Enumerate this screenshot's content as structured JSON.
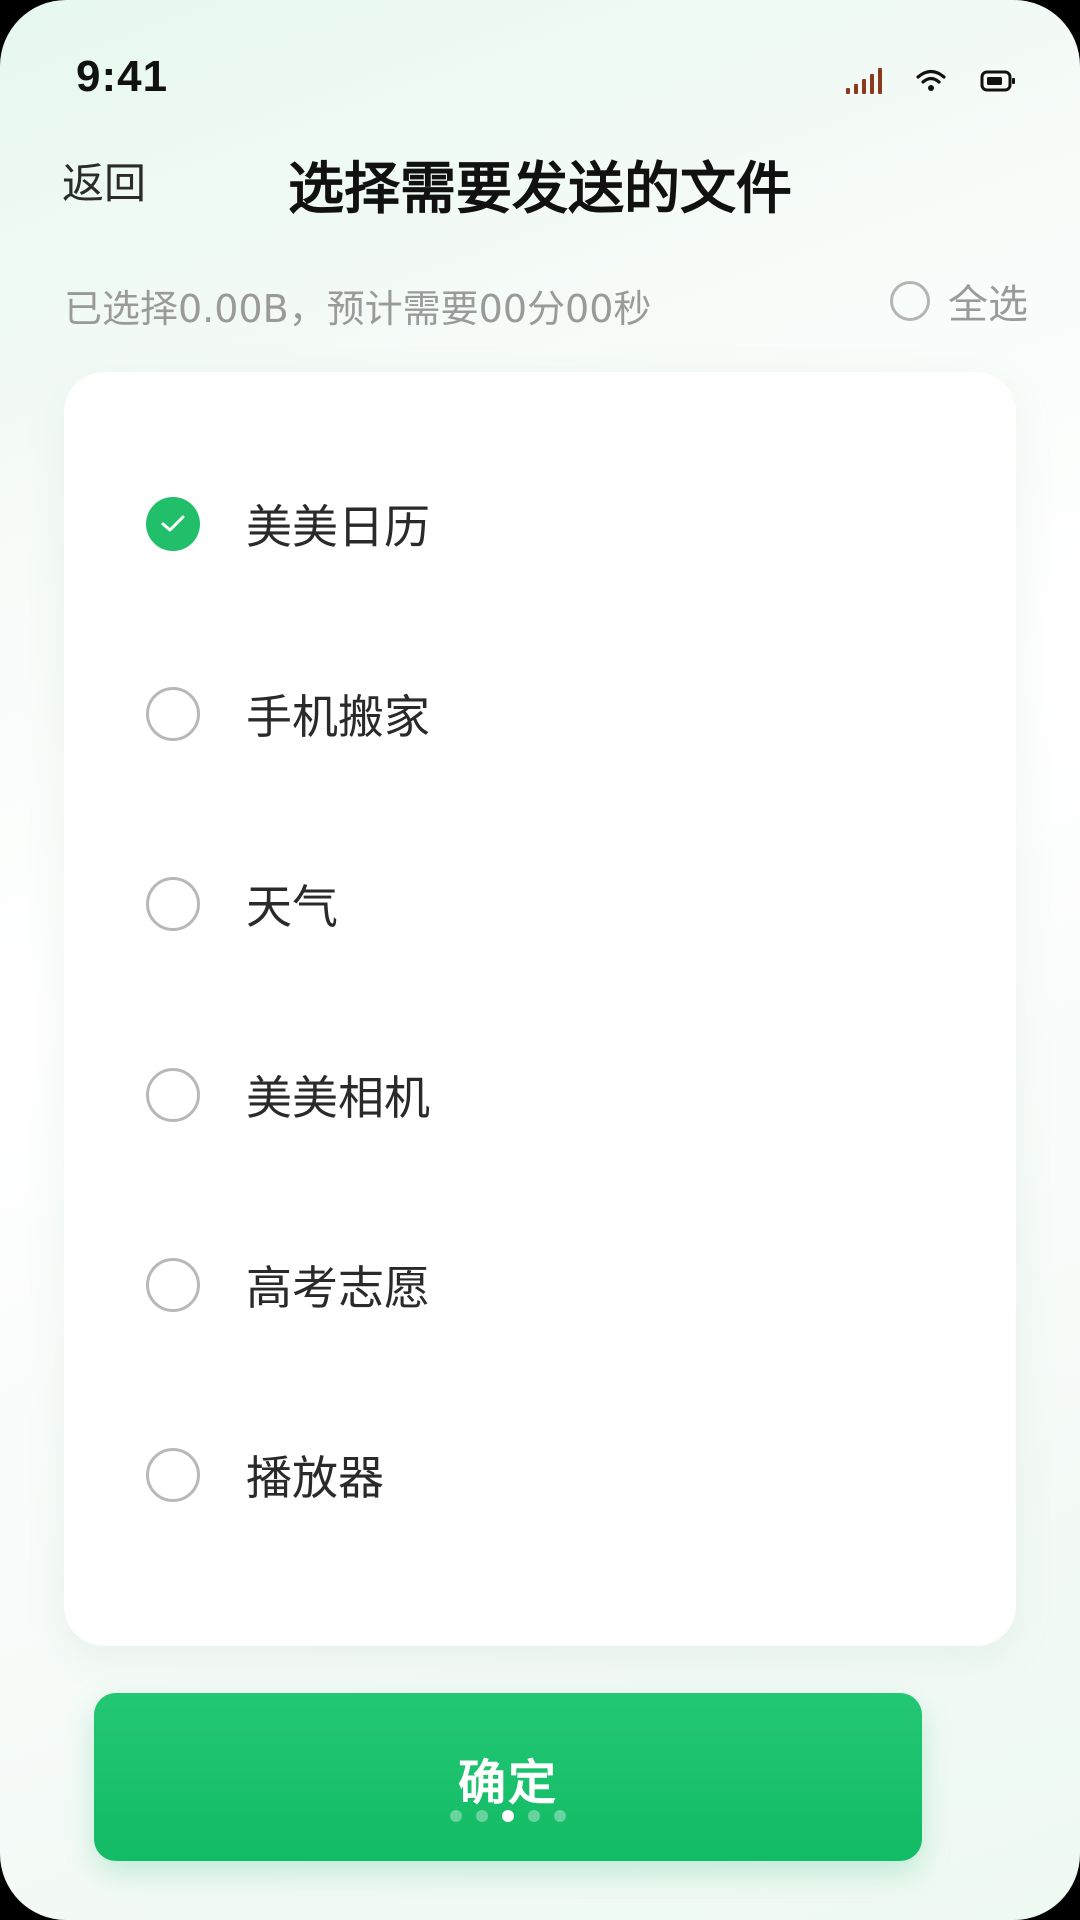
{
  "status_bar": {
    "time": "9:41",
    "icons": [
      "signal-icon",
      "wifi-icon",
      "battery-icon"
    ],
    "signal_color": "#8b3a1e"
  },
  "header": {
    "back_label": "返回",
    "title": "选择需要发送的文件"
  },
  "summary": {
    "text": "已选择0.00B，预计需要00分00秒",
    "select_all_label": "全选",
    "select_all_checked": false
  },
  "files": [
    {
      "label": "美美日历",
      "checked": true
    },
    {
      "label": "手机搬家",
      "checked": false
    },
    {
      "label": "天气",
      "checked": false
    },
    {
      "label": "美美相机",
      "checked": false
    },
    {
      "label": "高考志愿",
      "checked": false
    },
    {
      "label": "播放器",
      "checked": false
    }
  ],
  "confirm": {
    "label": "确定",
    "dots_total": 5,
    "dots_active_index": 2
  },
  "colors": {
    "accent": "#22bf6a",
    "button": "#12bb65",
    "text_primary": "#111111",
    "text_muted": "#9a9a9a"
  }
}
